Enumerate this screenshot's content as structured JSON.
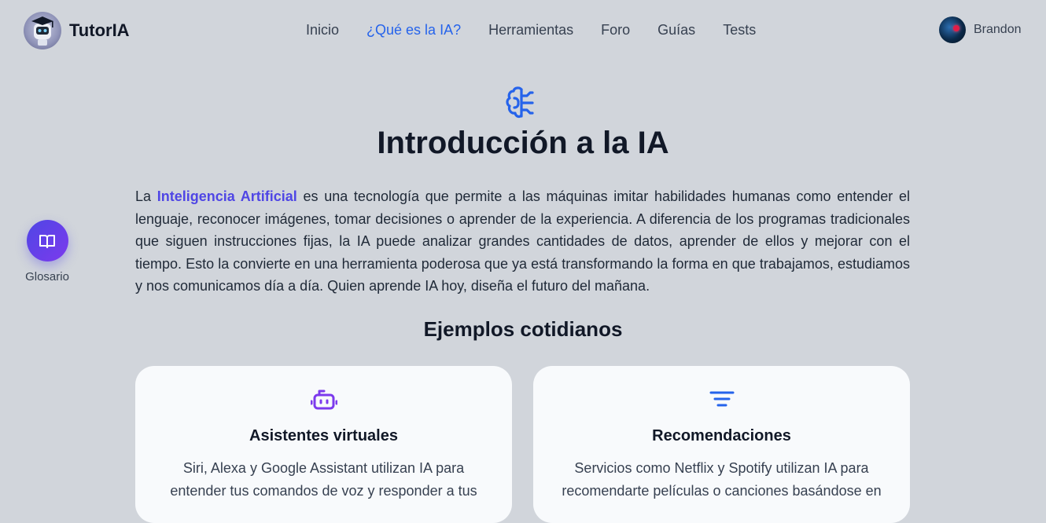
{
  "header": {
    "brand": "TutorIA",
    "nav": [
      "Inicio",
      "¿Qué es la IA?",
      "Herramientas",
      "Foro",
      "Guías",
      "Tests"
    ],
    "active_nav": "¿Qué es la IA?",
    "user_name": "Brandon"
  },
  "glossary": {
    "label": "Glosario"
  },
  "main": {
    "title": "Introducción a la IA",
    "intro_prefix": "La ",
    "intro_highlight": "Inteligencia Artificial",
    "intro_rest": " es una tecnología que permite a las máquinas imitar habilidades humanas como entender el lenguaje, reconocer imágenes, tomar decisiones o aprender de la experiencia. A diferencia de los programas tradicionales que siguen instrucciones fijas, la IA puede analizar grandes cantidades de datos, aprender de ellos y mejorar con el tiempo. Esto la convierte en una herramienta poderosa que ya está transformando la forma en que trabajamos, estudiamos y nos comunicamos día a día. Quien aprende IA hoy, diseña el futuro del mañana.",
    "section_title": "Ejemplos cotidianos",
    "cards": [
      {
        "icon": "robot-icon",
        "title": "Asistentes virtuales",
        "text": "Siri, Alexa y Google Assistant utilizan IA para entender tus comandos de voz y responder a tus"
      },
      {
        "icon": "filter-icon",
        "title": "Recomendaciones",
        "text": "Servicios como Netflix y Spotify utilizan IA para recomendarte películas o canciones basándose en"
      }
    ]
  },
  "colors": {
    "background": "#d1d5db",
    "accent": "#2563eb",
    "highlight": "#4f46e5",
    "card_bg": "#f8fafc",
    "robot_icon": "#7c3aed",
    "filter_icon": "#2563eb"
  }
}
